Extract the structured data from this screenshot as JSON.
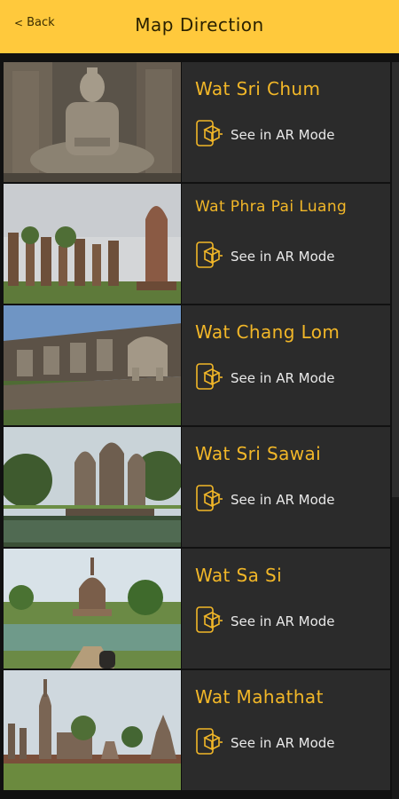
{
  "header": {
    "back_label": "Back",
    "title": "Map Direction"
  },
  "ar_label": "See in AR Mode",
  "places": [
    {
      "name": "Wat Sri Chum",
      "image": "seated-buddha-photo"
    },
    {
      "name": "Wat Phra Pai Luang",
      "image": "prang-ruins-photo"
    },
    {
      "name": "Wat Chang Lom",
      "image": "elephant-base-photo"
    },
    {
      "name": "Wat Sri Sawai",
      "image": "three-prangs-photo"
    },
    {
      "name": "Wat Sa Si",
      "image": "stupa-pond-photo"
    },
    {
      "name": "Wat Mahathat",
      "image": "chedi-complex-photo"
    }
  ],
  "colors": {
    "header_bg": "#FFC93C",
    "accent_gold": "#F2B728",
    "card_bg": "#2b2b2b",
    "page_bg": "#111111"
  }
}
